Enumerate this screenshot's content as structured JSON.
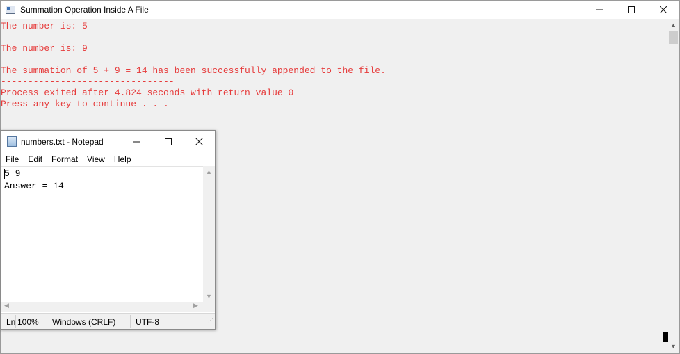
{
  "console": {
    "title": "Summation Operation Inside A File",
    "lines": [
      "The number is: 5",
      "The number is: 9",
      "The summation of 5 + 9 = 14 has been successfully appended to the file.",
      "--------------------------------",
      "Process exited after 4.824 seconds with return value 0",
      "Press any key to continue . . ."
    ],
    "text_color": "#e63b3b"
  },
  "notepad": {
    "title": "numbers.txt - Notepad",
    "menu": [
      "File",
      "Edit",
      "Format",
      "View",
      "Help"
    ],
    "content_lines": [
      "5 9",
      "Answer = 14"
    ],
    "status": {
      "position": "Ln",
      "zoom": "100%",
      "line_ending": "Windows (CRLF)",
      "encoding": "UTF-8"
    }
  },
  "icons": {
    "minimize": "minimize-icon",
    "maximize": "maximize-icon",
    "close": "close-icon"
  }
}
